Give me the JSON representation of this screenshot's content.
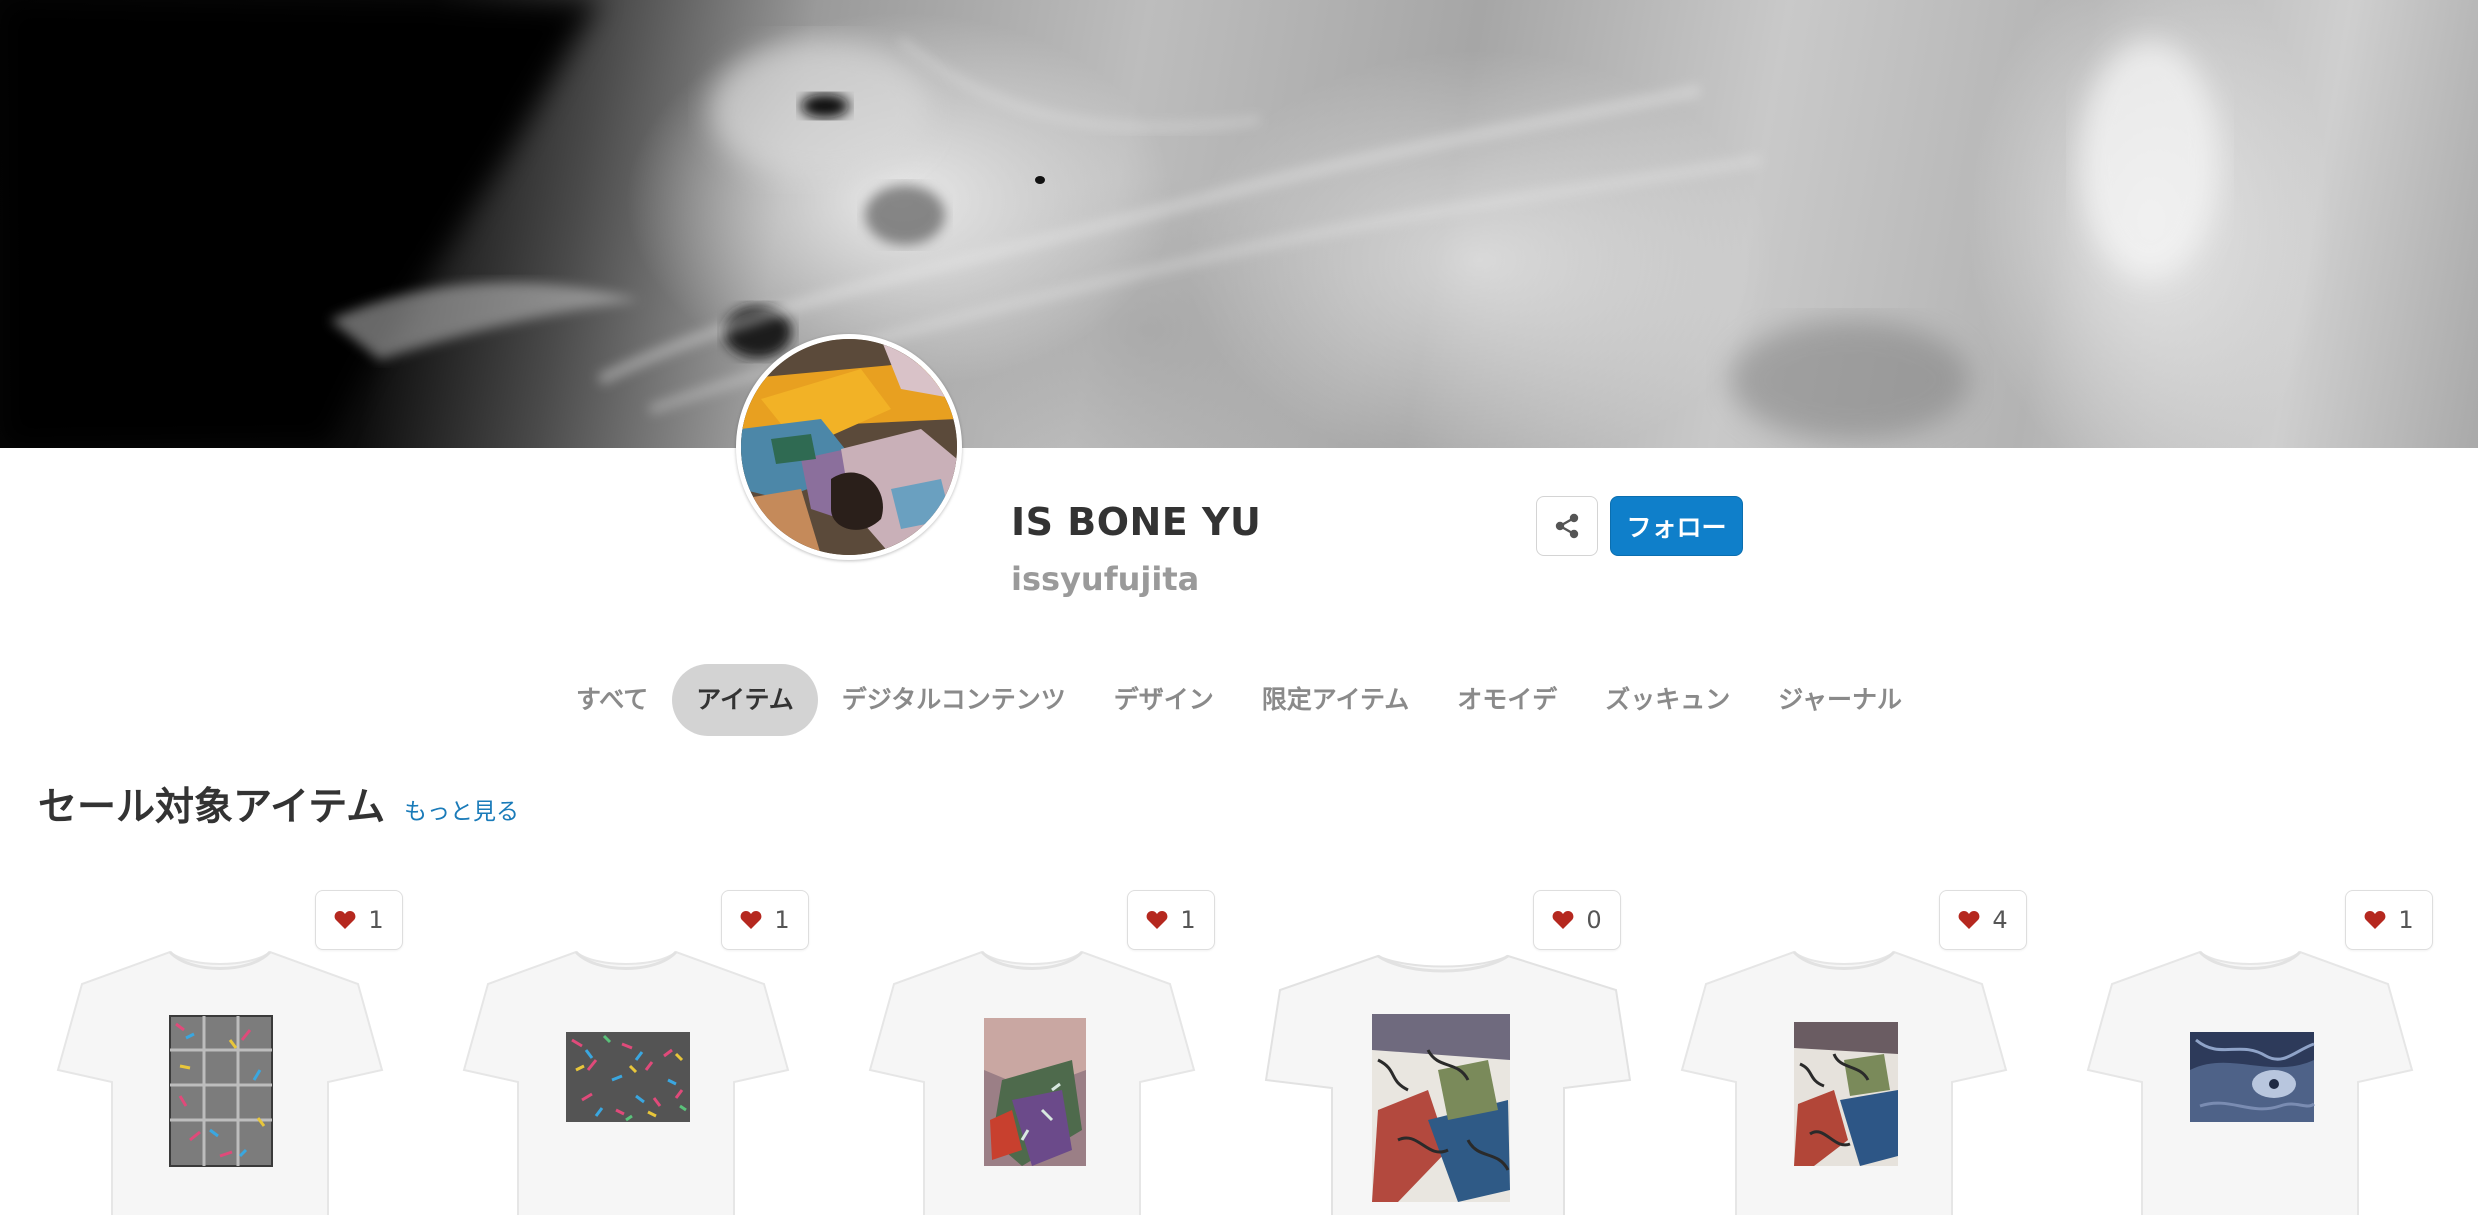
{
  "profile": {
    "name": "IS BONE YU",
    "id": "issyufujita",
    "follow_label": "フォロー"
  },
  "tabs": [
    {
      "label": "すべて",
      "active": false
    },
    {
      "label": "アイテム",
      "active": true
    },
    {
      "label": "デジタルコンテンツ",
      "active": false
    },
    {
      "label": "デザイン",
      "active": false
    },
    {
      "label": "限定アイテム",
      "active": false
    },
    {
      "label": "オモイデ",
      "active": false
    },
    {
      "label": "ズッキュン",
      "active": false
    },
    {
      "label": "ジャーナル",
      "active": false
    }
  ],
  "section": {
    "title": "セール対象アイテム",
    "more_label": "もっと見る"
  },
  "items": [
    {
      "likes": "1",
      "icon": "heart-icon"
    },
    {
      "likes": "1",
      "icon": "heart-icon"
    },
    {
      "likes": "1",
      "icon": "heart-icon"
    },
    {
      "likes": "0",
      "icon": "heart-icon"
    },
    {
      "likes": "4",
      "icon": "heart-icon"
    },
    {
      "likes": "1",
      "icon": "heart-icon"
    }
  ],
  "colors": {
    "accent": "#0f7fca",
    "link": "#1a7bb9",
    "heart": "#b5281f",
    "tab_active_bg": "#d3d3d3"
  }
}
